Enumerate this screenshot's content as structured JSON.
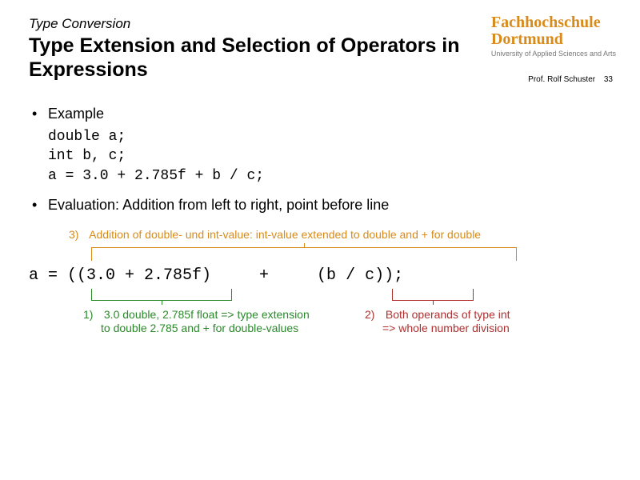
{
  "header": {
    "pretitle": "Type Conversion",
    "title": "Type Extension and Selection of Operators in Expressions"
  },
  "logo": {
    "line1": "Fachhochschule",
    "line2": "Dortmund",
    "sub": "University of Applied Sciences and Arts"
  },
  "author": {
    "name": "Prof. Rolf Schuster",
    "page": "33"
  },
  "bullets": {
    "b1_label": "Example",
    "b2_label": "Evaluation: Addition from left to right, point before line"
  },
  "code": {
    "l1": "double a;",
    "l2": "int b, c;",
    "l3": "a = 3.0 + 2.785f + b / c;"
  },
  "expr": "a = ((3.0 + 2.785f)     +     (b / c));",
  "ann": {
    "n3": "3)",
    "t3": "Addition of double- und int-value: int-value extended to double and + for double",
    "n1": "1)",
    "t1a": "3.0 double, 2.785f float => type extension",
    "t1b": "to double 2.785 and + for double-values",
    "n2": "2)",
    "t2a": "Both operands of type int",
    "t2b": "=> whole number division"
  }
}
